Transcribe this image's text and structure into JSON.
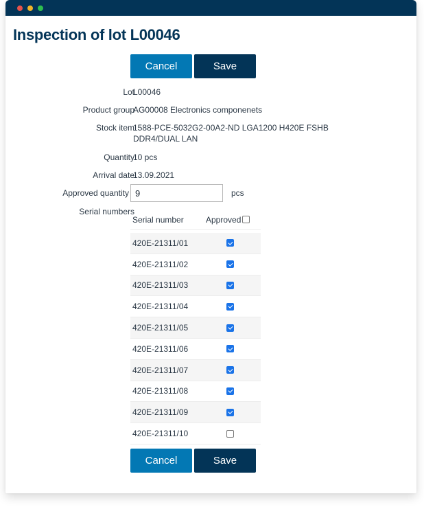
{
  "window": {
    "controls": [
      "close",
      "minimize",
      "maximize"
    ]
  },
  "page": {
    "title": "Inspection of lot L00046"
  },
  "actions": {
    "cancel_label": "Cancel",
    "save_label": "Save"
  },
  "fields": {
    "lot": {
      "label": "Lot",
      "value": "L00046"
    },
    "product_group": {
      "label": "Product group",
      "value": "AG00008 Electronics componenets"
    },
    "stock_item": {
      "label": "Stock item",
      "value_line1": "1588-PCE-5032G2-00A2-ND LGA1200 H420E FSHB",
      "value_line2": "DDR4/DUAL LAN"
    },
    "quantity": {
      "label": "Quantity",
      "value": "10 pcs"
    },
    "arrival_date": {
      "label": "Arrival date",
      "value": "13.09.2021"
    },
    "approved_quantity": {
      "label": "Approved quantity *",
      "value": "9",
      "unit": "pcs"
    },
    "serial_numbers": {
      "label": "Serial numbers"
    }
  },
  "serial_table": {
    "columns": {
      "serial": "Serial number",
      "approved": "Approved"
    },
    "select_all_checked": false,
    "rows": [
      {
        "serial": "420E-21311/01",
        "approved": true
      },
      {
        "serial": "420E-21311/02",
        "approved": true
      },
      {
        "serial": "420E-21311/03",
        "approved": true
      },
      {
        "serial": "420E-21311/04",
        "approved": true
      },
      {
        "serial": "420E-21311/05",
        "approved": true
      },
      {
        "serial": "420E-21311/06",
        "approved": true
      },
      {
        "serial": "420E-21311/07",
        "approved": true
      },
      {
        "serial": "420E-21311/08",
        "approved": true
      },
      {
        "serial": "420E-21311/09",
        "approved": true
      },
      {
        "serial": "420E-21311/10",
        "approved": false
      }
    ]
  },
  "colors": {
    "titlebar": "#033457",
    "cancel": "#0378b4",
    "save": "#033457",
    "checkbox_checked": "#1a73e8"
  }
}
